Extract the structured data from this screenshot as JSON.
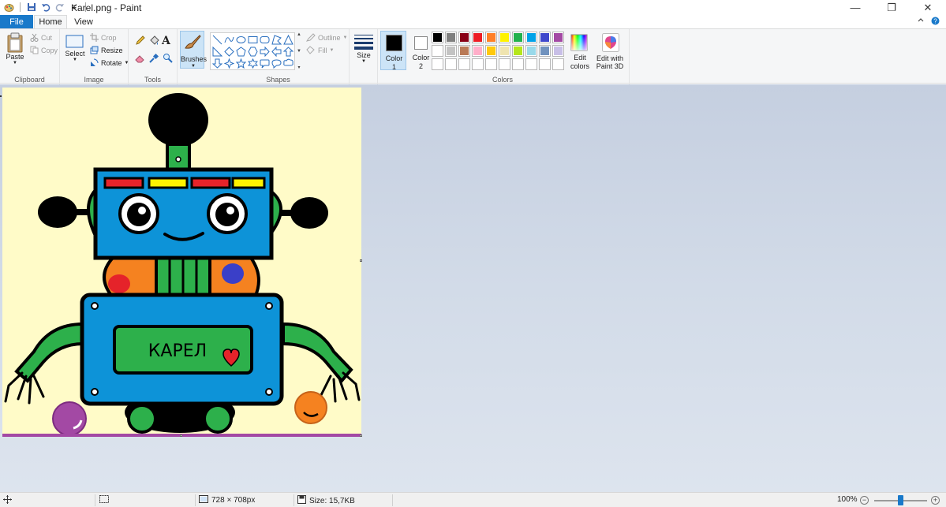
{
  "window": {
    "title": "Karel.png - Paint",
    "minimize": "—",
    "restore": "❐",
    "close": "✕"
  },
  "tabs": {
    "file": "File",
    "home": "Home",
    "view": "View"
  },
  "clipboard": {
    "paste": "Paste",
    "cut": "Cut",
    "copy": "Copy",
    "group": "Clipboard"
  },
  "image": {
    "select": "Select",
    "crop": "Crop",
    "resize": "Resize",
    "rotate": "Rotate",
    "group": "Image"
  },
  "tools": {
    "group": "Tools",
    "brushes": "Brushes"
  },
  "shapes": {
    "outline": "Outline",
    "fill": "Fill",
    "group": "Shapes"
  },
  "size": {
    "label": "Size"
  },
  "colors": {
    "color1_line1": "Color",
    "color1_line2": "1",
    "color2_line1": "Color",
    "color2_line2": "2",
    "edit_line1": "Edit",
    "edit_line2": "colors",
    "paint3d_line1": "Edit with",
    "paint3d_line2": "Paint 3D",
    "group": "Colors",
    "color1_value": "#000000",
    "color2_value": "#ffffff",
    "palette_row1": [
      "#000000",
      "#7f7f7f",
      "#880015",
      "#ed1c24",
      "#ff7f27",
      "#fff200",
      "#22b14c",
      "#00a2e8",
      "#3f48cc",
      "#a349a4"
    ],
    "palette_row2": [
      "#ffffff",
      "#c3c3c3",
      "#b97a57",
      "#ffaec9",
      "#ffc90e",
      "#efe4b0",
      "#b5e61d",
      "#99d9ea",
      "#7092be",
      "#c8bfe7"
    ]
  },
  "drawing": {
    "name_label": "КАРЕЛ"
  },
  "status": {
    "dimensions": "728 × 708px",
    "size": "Size: 15,7KB",
    "zoom": "100%"
  }
}
